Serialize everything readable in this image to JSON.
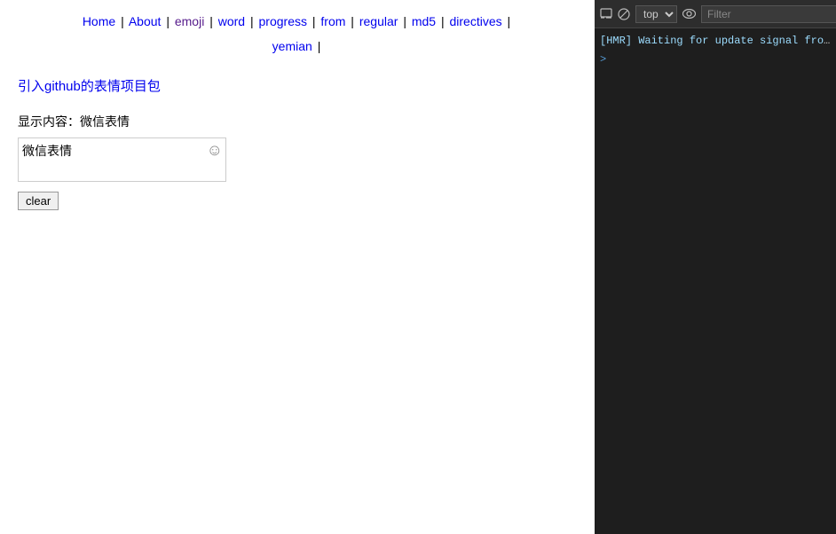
{
  "nav": {
    "items": [
      {
        "label": "Home",
        "href": "#",
        "active": false
      },
      {
        "label": "About",
        "href": "#",
        "active": false
      },
      {
        "label": "emoji",
        "href": "#",
        "active": true
      },
      {
        "label": "word",
        "href": "#",
        "active": false
      },
      {
        "label": "progress",
        "href": "#",
        "active": false
      },
      {
        "label": "from",
        "href": "#",
        "active": false
      },
      {
        "label": "regular",
        "href": "#",
        "active": false
      },
      {
        "label": "md5",
        "href": "#",
        "active": false
      },
      {
        "label": "directives",
        "href": "#",
        "active": false
      },
      {
        "label": "yemian",
        "href": "#",
        "active": false
      }
    ]
  },
  "main": {
    "github_link": "引入github的表情项目包",
    "display_label": "显示内容：微信表情",
    "textarea_value": "微信表情",
    "clear_button": "clear",
    "emoji_icon": "☺"
  },
  "devtools": {
    "top_select": "top",
    "filter_placeholder": "Filter",
    "console_lines": [
      "[HMR] Waiting for update signal from W"
    ],
    "prompt": ">"
  }
}
